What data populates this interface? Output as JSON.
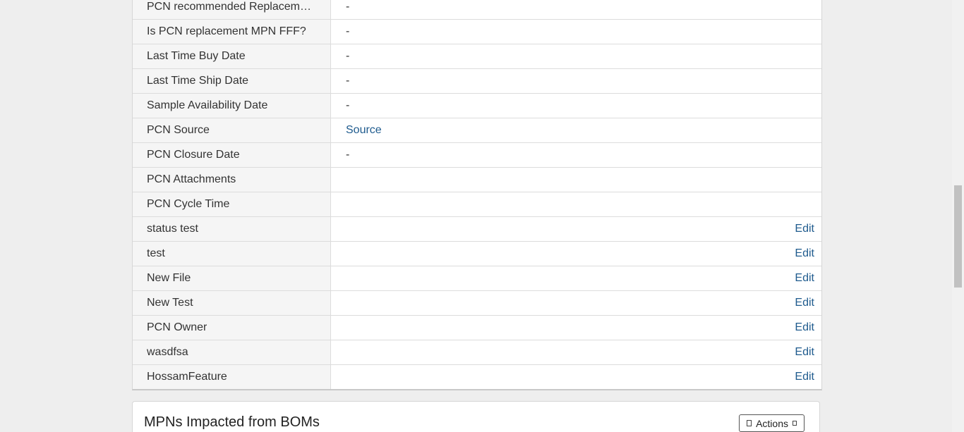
{
  "details": {
    "rows": [
      {
        "label": "PCN recommended Replacement MPN",
        "value": "-"
      },
      {
        "label": "Is PCN replacement MPN FFF?",
        "value": "-"
      },
      {
        "label": "Last Time Buy Date",
        "value": "-"
      },
      {
        "label": "Last Time Ship Date",
        "value": "-"
      },
      {
        "label": "Sample Availability Date",
        "value": "-"
      },
      {
        "label": "PCN Source",
        "value": "Source"
      },
      {
        "label": "PCN Closure Date",
        "value": "-"
      },
      {
        "label": "PCN Attachments",
        "value": ""
      },
      {
        "label": "PCN Cycle Time",
        "value": ""
      },
      {
        "label": "status test",
        "value": "",
        "action": "Edit"
      },
      {
        "label": "test",
        "value": "",
        "action": "Edit"
      },
      {
        "label": "New File",
        "value": "",
        "action": "Edit"
      },
      {
        "label": "New Test",
        "value": "",
        "action": "Edit"
      },
      {
        "label": "PCN Owner",
        "value": "",
        "action": "Edit"
      },
      {
        "label": "wasdfsa",
        "value": "",
        "action": "Edit"
      },
      {
        "label": "HossamFeature",
        "value": "",
        "action": "Edit"
      }
    ]
  },
  "panel": {
    "title": "MPNs Impacted from BOMs",
    "actions_label": "Actions"
  },
  "colors": {
    "link": "#1f5b8e",
    "label_bg": "#f5f5f5",
    "page_bg": "#eeeeee"
  }
}
